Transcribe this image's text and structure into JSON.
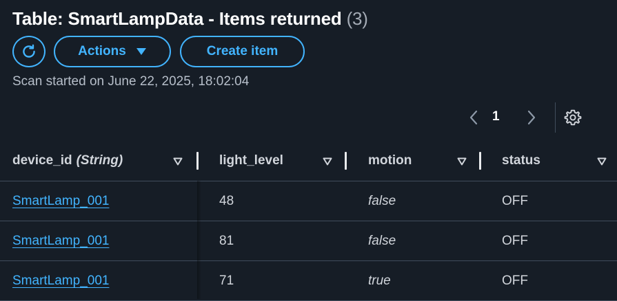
{
  "header": {
    "title": "Table: SmartLampData - Items returned",
    "count": "(3)"
  },
  "toolbar": {
    "refresh_icon": "refresh-icon",
    "actions_label": "Actions",
    "actions_icon": "caret-down-icon",
    "create_label": "Create item"
  },
  "scan_info": "Scan started on June 22, 2025, 18:02:04",
  "pagination": {
    "current_page": "1",
    "prev_icon": "chevron-left-icon",
    "next_icon": "chevron-right-icon",
    "settings_icon": "gear-icon"
  },
  "table": {
    "columns": [
      {
        "name": "device_id",
        "type": "(String)"
      },
      {
        "name": "light_level"
      },
      {
        "name": "motion"
      },
      {
        "name": "status"
      }
    ],
    "rows": [
      {
        "device_id": "SmartLamp_001",
        "light_level": "48",
        "motion": "false",
        "status": "OFF"
      },
      {
        "device_id": "SmartLamp_001",
        "light_level": "81",
        "motion": "false",
        "status": "OFF"
      },
      {
        "device_id": "SmartLamp_001",
        "light_level": "71",
        "motion": "true",
        "status": "OFF"
      }
    ]
  },
  "colors": {
    "background": "#161d26",
    "accent": "#42b4ff",
    "text": "#d1d5db",
    "divider": "#414d5c"
  }
}
